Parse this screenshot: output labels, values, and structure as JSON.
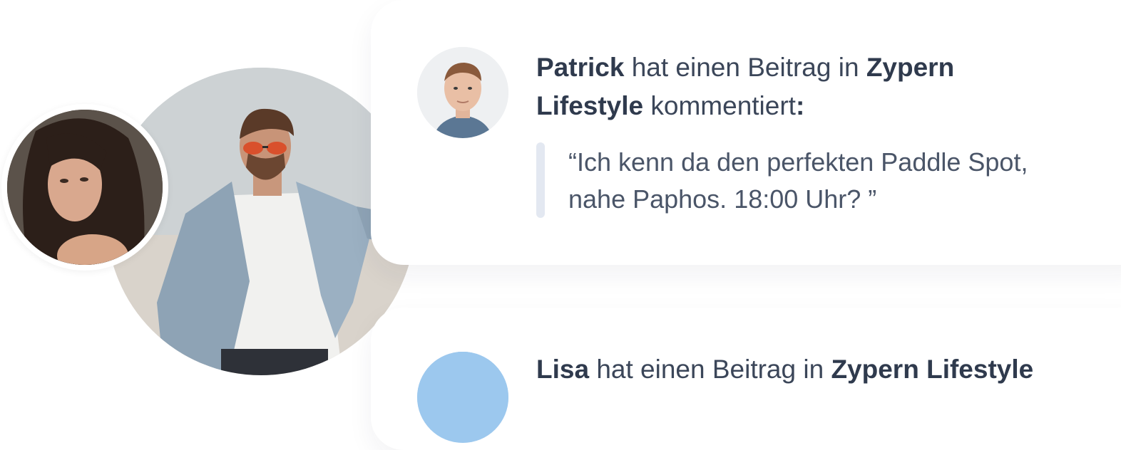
{
  "feed": [
    {
      "user": "Patrick",
      "action": "hat einen Beitrag in",
      "group_line1": "Zypern",
      "group_line2": "Lifestyle",
      "verb": "kommentiert",
      "colon": ":",
      "quote": "“Ich kenn da den perfekten Paddle Spot, nahe Paphos. 18:00 Uhr?    ”"
    },
    {
      "user": "Lisa",
      "action": "hat einen Beitrag in",
      "group": "Zypern Lifestyle"
    }
  ]
}
